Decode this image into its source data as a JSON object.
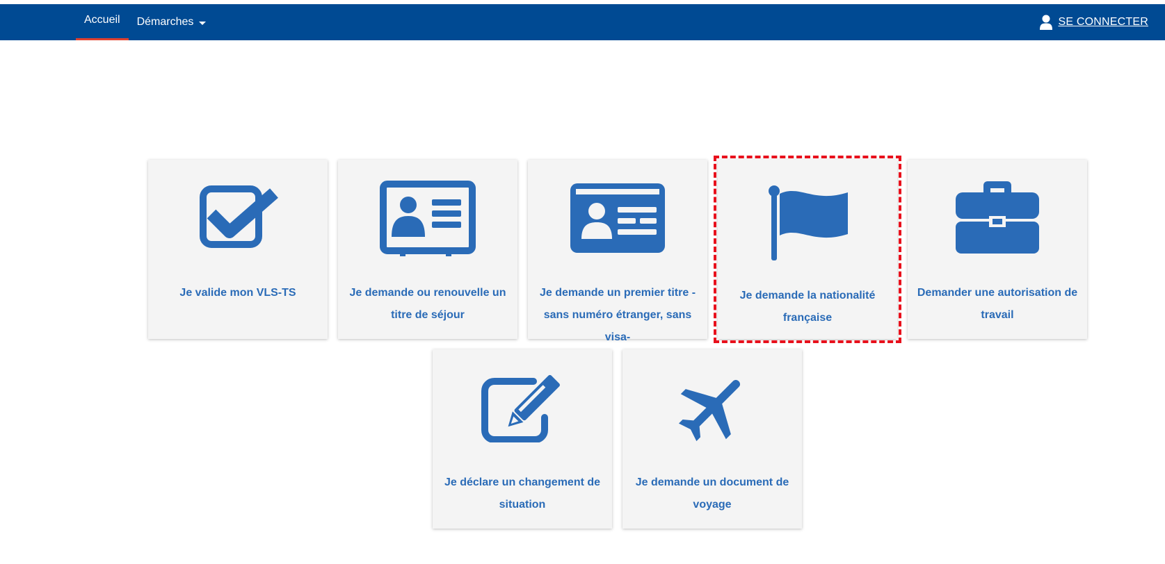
{
  "nav": {
    "items": [
      {
        "label": "Accueil",
        "active": true
      },
      {
        "label": "Démarches",
        "active": false
      }
    ],
    "login_label": "SE CONNECTER"
  },
  "colors": {
    "topbar": "#004a93",
    "active_underline": "#e2412e",
    "icon": "#2a6bb7",
    "card_bg": "#f4f4f4",
    "highlight": "#e8101c"
  },
  "cards": [
    {
      "label": "Je valide mon VLS-TS",
      "icon": "checkbox-icon"
    },
    {
      "label": "Je demande ou renouvelle un titre de séjour",
      "icon": "id-card-icon"
    },
    {
      "label": "Je demande un premier titre -sans numéro étranger, sans visa-",
      "icon": "id-badge-icon"
    },
    {
      "label": "Je demande la nationalité française",
      "icon": "flag-icon",
      "highlighted": true
    },
    {
      "label": "Demander une autorisation de travail",
      "icon": "briefcase-icon"
    },
    {
      "label": "Je déclare un changement de situation",
      "icon": "edit-icon"
    },
    {
      "label": "Je demande un document de voyage",
      "icon": "plane-icon"
    }
  ]
}
